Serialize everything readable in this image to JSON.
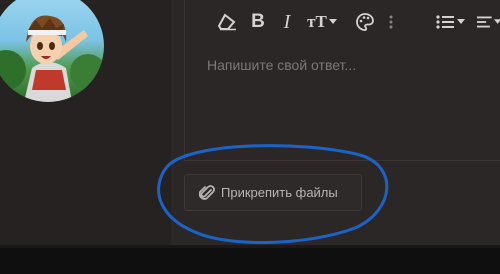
{
  "editor": {
    "placeholder": "Напишите свой ответ...",
    "toolbar": {
      "icons": [
        "eraser-icon",
        "bold-icon",
        "italic-icon",
        "text-size-icon",
        "palette-icon",
        "more-vertical-icon",
        "list-icon",
        "align-icon"
      ],
      "bold_glyph": "B",
      "italic_glyph": "I",
      "text_size_glyph": "тТ"
    }
  },
  "attach": {
    "label": "Прикрепить файлы"
  },
  "colors": {
    "background": "#262222",
    "annotation_circle": "#1b63c6"
  }
}
